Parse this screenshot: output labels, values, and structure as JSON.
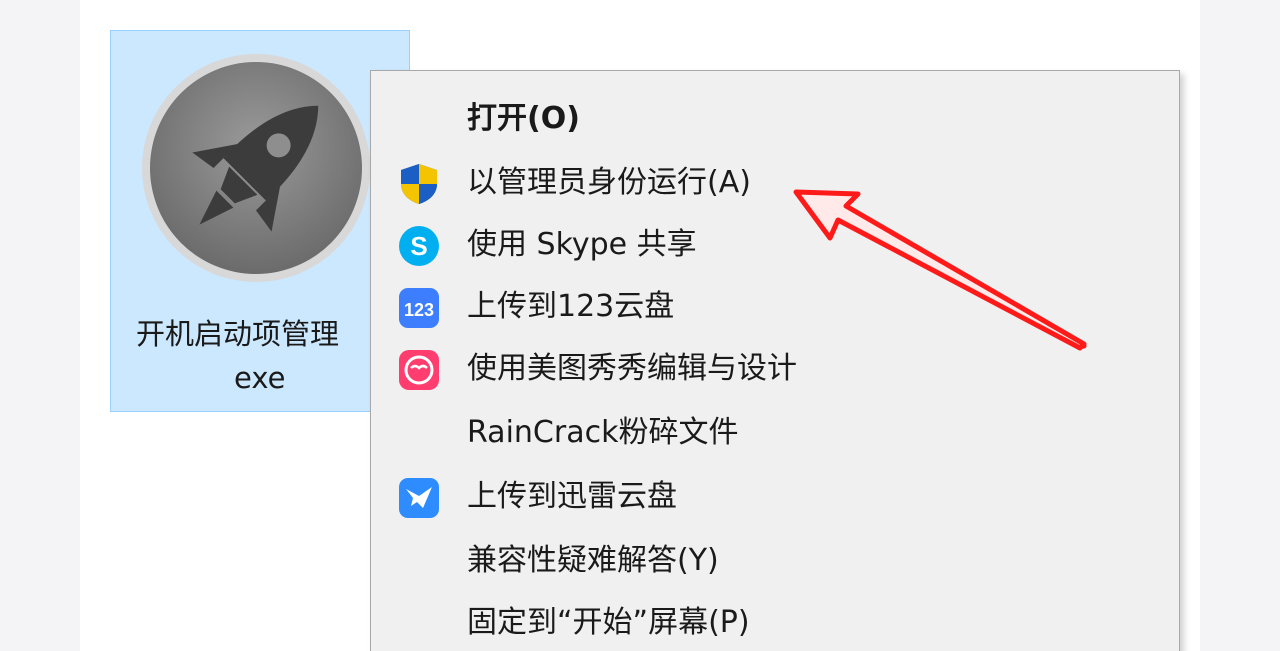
{
  "file": {
    "name_line1": "开机启动项管理",
    "name_line2": "exe",
    "icon": "rocket-icon"
  },
  "menu": {
    "items": [
      {
        "label": "打开(O)",
        "icon": "",
        "bold": true
      },
      {
        "label": "以管理员身份运行(A)",
        "icon": "uac-shield-icon"
      },
      {
        "label": "使用 Skype 共享",
        "icon": "skype-icon"
      },
      {
        "label": "上传到123云盘",
        "icon": "123-cloud-icon"
      },
      {
        "label": "使用美图秀秀编辑与设计",
        "icon": "meitu-icon"
      },
      {
        "label": "RainCrack粉碎文件",
        "icon": ""
      },
      {
        "label": "上传到迅雷云盘",
        "icon": "xunlei-icon"
      },
      {
        "label": "兼容性疑难解答(Y)",
        "icon": ""
      },
      {
        "label": "固定到“开始”屏幕(P)",
        "icon": ""
      }
    ]
  },
  "colors": {
    "selection": "#cce8ff",
    "menu_bg": "#f0f0f0",
    "annotation_arrow": "#ff1a1a"
  }
}
